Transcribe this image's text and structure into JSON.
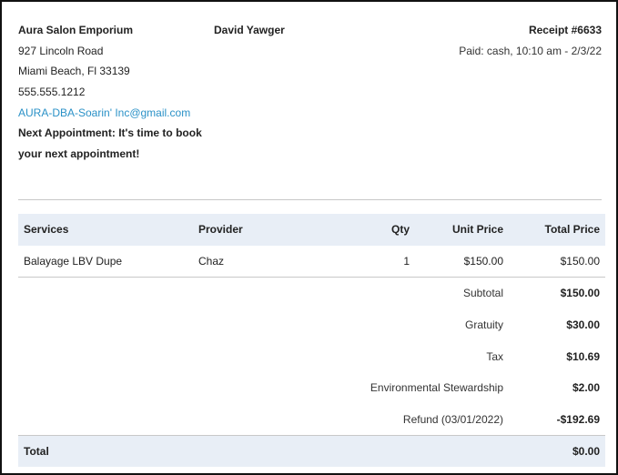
{
  "business": {
    "name": "Aura Salon Emporium",
    "address1": "927 Lincoln Road",
    "address2": "Miami Beach, Fl 33139",
    "phone": "555.555.1212",
    "email": "AURA-DBA-Soarin' Inc@gmail.com",
    "next_appointment": "Next Appointment: It's time to book your next appointment!"
  },
  "client": {
    "name": "David Yawger"
  },
  "receipt": {
    "number": "Receipt #6633",
    "paid": "Paid: cash, 10:10 am - 2/3/22"
  },
  "table": {
    "headers": {
      "services": "Services",
      "provider": "Provider",
      "qty": "Qty",
      "unit_price": "Unit Price",
      "total_price": "Total Price"
    },
    "items": [
      {
        "service": "Balayage LBV Dupe",
        "provider": "Chaz",
        "qty": "1",
        "unit_price": "$150.00",
        "total_price": "$150.00"
      }
    ],
    "summary": [
      {
        "label": "Subtotal",
        "value": "$150.00"
      },
      {
        "label": "Gratuity",
        "value": "$30.00"
      },
      {
        "label": "Tax",
        "value": "$10.69"
      },
      {
        "label": "Environmental Stewardship",
        "value": "$2.00"
      },
      {
        "label": "Refund (03/01/2022)",
        "value": "-$192.69"
      }
    ],
    "total": {
      "label": "Total",
      "value": "$0.00"
    }
  },
  "colors": {
    "header_bg": "#e8eef6",
    "link": "#2a91c7",
    "divider": "#c8c8c8"
  }
}
